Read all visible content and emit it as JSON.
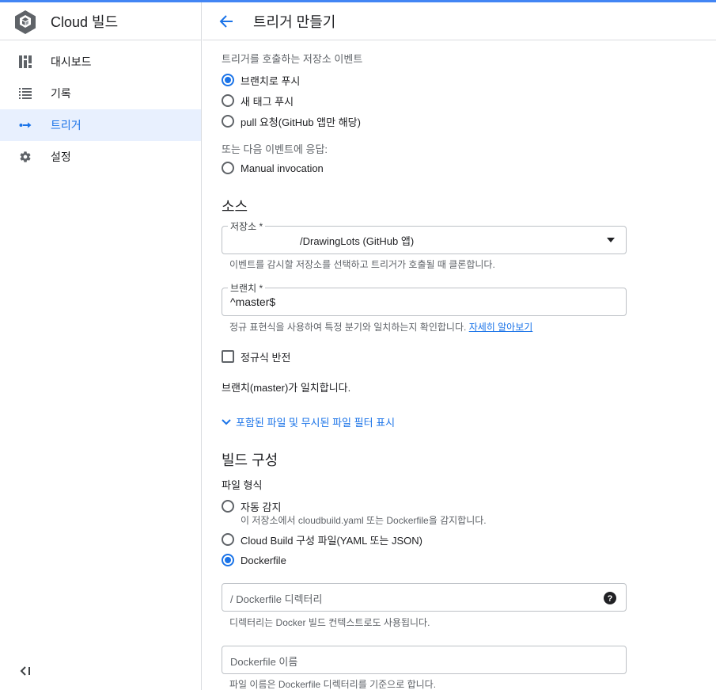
{
  "app": {
    "title": "Cloud 빌드"
  },
  "sidebar": {
    "items": [
      {
        "label": "대시보드",
        "icon": "dashboard-icon",
        "active": false
      },
      {
        "label": "기록",
        "icon": "list-icon",
        "active": false
      },
      {
        "label": "트리거",
        "icon": "trigger-icon",
        "active": true
      },
      {
        "label": "설정",
        "icon": "gear-icon",
        "active": false
      }
    ],
    "collapse_icon": "collapse-sidebar-icon"
  },
  "header": {
    "title": "트리거 만들기",
    "back_icon": "arrow-back-icon"
  },
  "event": {
    "label": "트리거를 호출하는 저장소 이벤트",
    "options": [
      {
        "label": "브랜치로 푸시",
        "selected": true
      },
      {
        "label": "새 태그 푸시",
        "selected": false
      },
      {
        "label": "pull 요청(GitHub 앱만 해당)",
        "selected": false
      }
    ],
    "alt_label": "또는 다음 이벤트에 응답:",
    "alt_option": {
      "label": "Manual invocation",
      "selected": false
    }
  },
  "source": {
    "title": "소스",
    "repo_label": "저장소 *",
    "repo_value": "/DrawingLots (GitHub 앱)",
    "repo_hint": "이벤트를 감시할 저장소를 선택하고 트리거가 호출될 때 클론합니다.",
    "branch_label": "브랜치 *",
    "branch_value": "^master$",
    "branch_hint": "정규 표현식을 사용하여 특정 분기와 일치하는지 확인합니다.",
    "branch_link": "자세히 알아보기",
    "invert_label": "정규식 반전",
    "match_text": "브랜치(master)가 일치합니다.",
    "filter_toggle": "포함된 파일 및 무시된 파일 필터 표시"
  },
  "build": {
    "title": "빌드 구성",
    "file_type_label": "파일 형식",
    "options": [
      {
        "label": "자동 감지",
        "selected": false,
        "sub": "이 저장소에서 cloudbuild.yaml 또는 Dockerfile을 감지합니다."
      },
      {
        "label": "Cloud Build 구성 파일(YAML 또는 JSON)",
        "selected": false
      },
      {
        "label": "Dockerfile",
        "selected": true
      }
    ],
    "dir_placeholder": "/ Dockerfile 디렉터리",
    "dir_hint": "디렉터리는 Docker 빌드 컨텍스트로도 사용됩니다.",
    "name_placeholder": "Dockerfile 이름",
    "name_hint": "파일 이름은 Dockerfile 디렉터리를 기준으로 합니다."
  },
  "colors": {
    "accent": "#1a73e8",
    "topbar": "#4285f4",
    "active_bg": "#e8f0fe"
  }
}
